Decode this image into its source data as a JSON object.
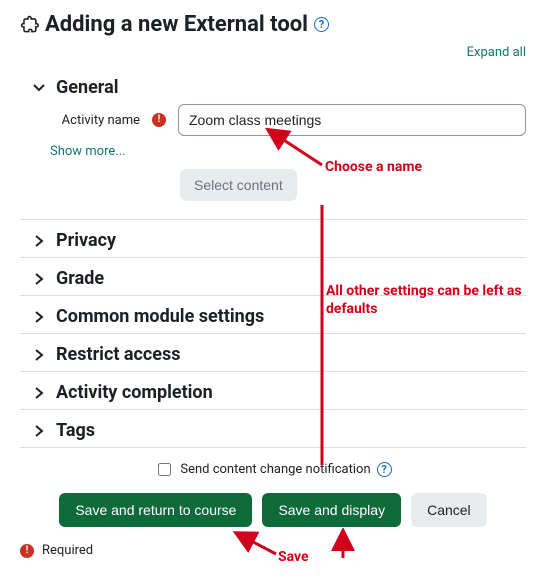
{
  "header": {
    "title": "Adding a new External tool",
    "expand_all": "Expand all"
  },
  "general": {
    "title": "General",
    "activity_name_label": "Activity name",
    "activity_name_value": "Zoom class meetings",
    "show_more": "Show more...",
    "select_content": "Select content"
  },
  "sections": [
    {
      "title": "Privacy"
    },
    {
      "title": "Grade"
    },
    {
      "title": "Common module settings"
    },
    {
      "title": "Restrict access"
    },
    {
      "title": "Activity completion"
    },
    {
      "title": "Tags"
    }
  ],
  "footer": {
    "notify_label": "Send content change notification",
    "save_return": "Save and return to course",
    "save_display": "Save and display",
    "cancel": "Cancel",
    "required": "Required"
  },
  "annotations": {
    "choose_name": "Choose a name",
    "defaults": "All other settings can be left as defaults",
    "save": "Save"
  }
}
